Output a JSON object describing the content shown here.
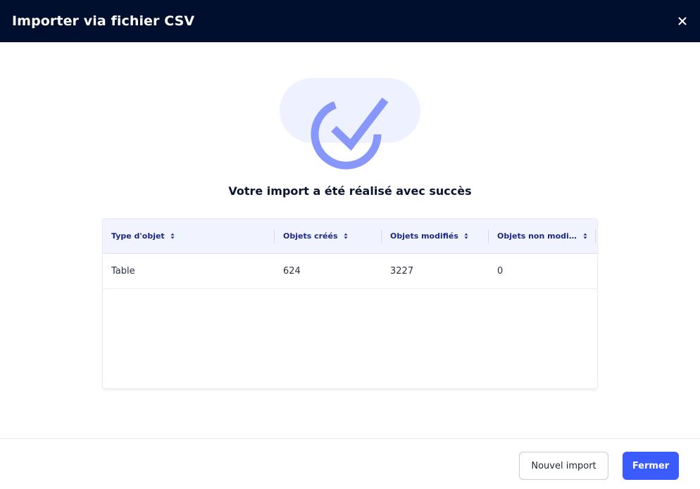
{
  "modal": {
    "title": "Importer via fichier CSV",
    "close_icon": "close-icon"
  },
  "illustration": {
    "icon": "check-circle-icon",
    "colors": {
      "blob": "#eef1ff",
      "check": "#8797fb"
    }
  },
  "message": "Votre import a été réalisé avec succès",
  "table": {
    "columns": [
      {
        "label": "Type d'objet",
        "sort_icon": "sort-icon"
      },
      {
        "label": "Objets créés",
        "sort_icon": "sort-icon"
      },
      {
        "label": "Objets modifiés",
        "sort_icon": "sort-icon"
      },
      {
        "label": "Objets non modifiés",
        "sort_icon": "sort-icon"
      }
    ],
    "rows": [
      {
        "type": "Table",
        "created": "624",
        "modified": "3227",
        "unmodified": "0"
      }
    ]
  },
  "buttons": {
    "new_import": "Nouvel import",
    "close": "Fermer"
  },
  "colors": {
    "header_bg": "#000f2e",
    "primary": "#3a5bff",
    "table_header_bg": "#f1f4ff",
    "table_header_text": "#1b2a8a"
  }
}
